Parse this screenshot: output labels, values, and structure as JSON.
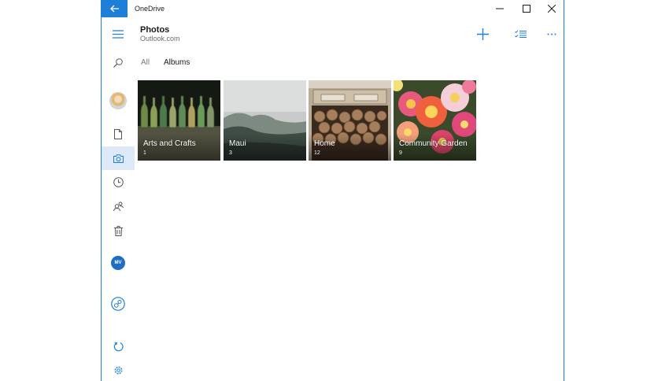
{
  "titlebar": {
    "app_title": "OneDrive",
    "back_icon": "arrow-left-icon",
    "controls": [
      "minimize-icon",
      "maximize-icon",
      "close-icon"
    ]
  },
  "header": {
    "title": "Photos",
    "subtitle": "Outlook.com",
    "actions": [
      "add-icon",
      "select-list-icon",
      "more-icon"
    ]
  },
  "tabs": [
    {
      "label": "All",
      "selected": false
    },
    {
      "label": "Albums",
      "selected": true
    }
  ],
  "rail": {
    "items": [
      "hamburger-menu-icon",
      "search-icon",
      "avatar",
      "files-icon",
      "photos-icon",
      "recent-icon",
      "shared-icon",
      "recycle-bin-icon",
      "account-badge",
      "onedrive-logo-icon",
      "sync-icon",
      "settings-icon"
    ],
    "active": "photos-icon",
    "account_initials": "MV"
  },
  "albums": [
    {
      "name": "Arts and Crafts",
      "count": "1"
    },
    {
      "name": "Maui",
      "count": "3"
    },
    {
      "name": "Home",
      "count": "12"
    },
    {
      "name": "Community Garden",
      "count": "9"
    }
  ],
  "colors": {
    "accent": "#1e7fd6",
    "rail_active": "#dde9f6",
    "badge": "#1e6fc4"
  }
}
